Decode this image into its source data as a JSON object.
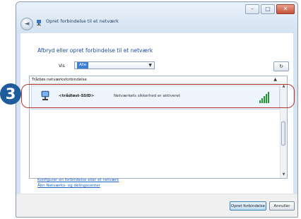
{
  "window": {
    "title": "Opret forbindelse til et netværk",
    "controls": {
      "minimize": "–",
      "maximize": "□",
      "close": "✕"
    },
    "back_symbol": "◄"
  },
  "main": {
    "heading": "Afbryd eller opret forbindelse til et netværk",
    "filter": {
      "label": "Vis",
      "value": "Alle",
      "arrow": "▼"
    },
    "refresh_symbol": "↻",
    "list": {
      "group_header": "Trådløs netværksforbindelse",
      "collapse_symbol": "▲",
      "networks": [
        {
          "name": "<trådløst-SSID>",
          "status": "Netværkets sikkerhed er aktiveret",
          "signal_level": 5,
          "icon": "network-computer-icon"
        }
      ]
    },
    "scroll_up": "▲",
    "scroll_down": "▼",
    "links": [
      "Konfigurer en forbindelse eller et netværk",
      "Åbn Netværks- og delingscenter"
    ]
  },
  "footer": {
    "connect_label": "Opret forbindelse",
    "cancel_label": "Annuller"
  },
  "overlay": {
    "step_number": "3",
    "colors": {
      "badge": "#1e5c9b",
      "highlight": "#b8362e",
      "signal": "#1f9a2f"
    }
  }
}
